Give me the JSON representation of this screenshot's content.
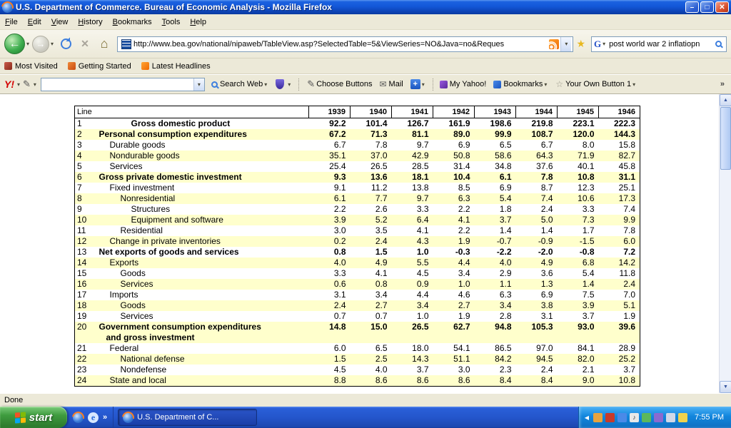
{
  "window": {
    "title": "U.S. Department of Commerce. Bureau of Economic Analysis - Mozilla Firefox"
  },
  "icons": {
    "dropdown": "▾",
    "back_arrow": "←",
    "forward_arrow": "→",
    "stop": "✕",
    "home": "⌂",
    "star": "★",
    "pencil": "✎",
    "mail": "✉",
    "plus": "+",
    "overflow": "»",
    "minimize": "–",
    "maximize": "□",
    "close": "✕",
    "up_arrow": "▲",
    "down_arrow": "▼",
    "tray_chevron": "◀",
    "own_star": "☆"
  },
  "menubar": {
    "items": [
      "File",
      "Edit",
      "View",
      "History",
      "Bookmarks",
      "Tools",
      "Help"
    ]
  },
  "navbar": {
    "url": "http://www.bea.gov/national/nipaweb/TableView.asp?SelectedTable=5&ViewSeries=NO&Java=no&Reques",
    "search_engine_label": "G",
    "search_value": "post world war 2 inflatiopn"
  },
  "bookmarks_bar": {
    "items": [
      "Most Visited",
      "Getting Started",
      "Latest Headlines"
    ]
  },
  "yahoo_bar": {
    "logo": "Y!",
    "search_button": "Search Web",
    "buttons": [
      "Choose Buttons",
      "Mail",
      "My Yahoo!",
      "Bookmarks",
      "Your Own Button 1"
    ]
  },
  "table": {
    "line_header": "Line",
    "years": [
      "1939",
      "1940",
      "1941",
      "1942",
      "1943",
      "1944",
      "1945",
      "1946"
    ],
    "rows": [
      {
        "line": "1",
        "label": "Gross domestic product",
        "indent": 3,
        "bold": true,
        "values": [
          "92.2",
          "101.4",
          "126.7",
          "161.9",
          "198.6",
          "219.8",
          "223.1",
          "222.3"
        ]
      },
      {
        "line": "2",
        "label": "Personal consumption expenditures",
        "indent": 0,
        "bold": true,
        "values": [
          "67.2",
          "71.3",
          "81.1",
          "89.0",
          "99.9",
          "108.7",
          "120.0",
          "144.3"
        ]
      },
      {
        "line": "3",
        "label": "Durable goods",
        "indent": 1,
        "bold": false,
        "values": [
          "6.7",
          "7.8",
          "9.7",
          "6.9",
          "6.5",
          "6.7",
          "8.0",
          "15.8"
        ]
      },
      {
        "line": "4",
        "label": "Nondurable goods",
        "indent": 1,
        "bold": false,
        "values": [
          "35.1",
          "37.0",
          "42.9",
          "50.8",
          "58.6",
          "64.3",
          "71.9",
          "82.7"
        ]
      },
      {
        "line": "5",
        "label": "Services",
        "indent": 1,
        "bold": false,
        "values": [
          "25.4",
          "26.5",
          "28.5",
          "31.4",
          "34.8",
          "37.6",
          "40.1",
          "45.8"
        ]
      },
      {
        "line": "6",
        "label": "Gross private domestic investment",
        "indent": 0,
        "bold": true,
        "values": [
          "9.3",
          "13.6",
          "18.1",
          "10.4",
          "6.1",
          "7.8",
          "10.8",
          "31.1"
        ]
      },
      {
        "line": "7",
        "label": "Fixed investment",
        "indent": 1,
        "bold": false,
        "values": [
          "9.1",
          "11.2",
          "13.8",
          "8.5",
          "6.9",
          "8.7",
          "12.3",
          "25.1"
        ]
      },
      {
        "line": "8",
        "label": "Nonresidential",
        "indent": 2,
        "bold": false,
        "values": [
          "6.1",
          "7.7",
          "9.7",
          "6.3",
          "5.4",
          "7.4",
          "10.6",
          "17.3"
        ]
      },
      {
        "line": "9",
        "label": "Structures",
        "indent": 3,
        "bold": false,
        "values": [
          "2.2",
          "2.6",
          "3.3",
          "2.2",
          "1.8",
          "2.4",
          "3.3",
          "7.4"
        ]
      },
      {
        "line": "10",
        "label": "Equipment and software",
        "indent": 3,
        "bold": false,
        "values": [
          "3.9",
          "5.2",
          "6.4",
          "4.1",
          "3.7",
          "5.0",
          "7.3",
          "9.9"
        ]
      },
      {
        "line": "11",
        "label": "Residential",
        "indent": 2,
        "bold": false,
        "values": [
          "3.0",
          "3.5",
          "4.1",
          "2.2",
          "1.4",
          "1.4",
          "1.7",
          "7.8"
        ]
      },
      {
        "line": "12",
        "label": "Change in private inventories",
        "indent": 1,
        "bold": false,
        "values": [
          "0.2",
          "2.4",
          "4.3",
          "1.9",
          "-0.7",
          "-0.9",
          "-1.5",
          "6.0"
        ]
      },
      {
        "line": "13",
        "label": "Net exports of goods and services",
        "indent": 0,
        "bold": true,
        "values": [
          "0.8",
          "1.5",
          "1.0",
          "-0.3",
          "-2.2",
          "-2.0",
          "-0.8",
          "7.2"
        ]
      },
      {
        "line": "14",
        "label": "Exports",
        "indent": 1,
        "bold": false,
        "values": [
          "4.0",
          "4.9",
          "5.5",
          "4.4",
          "4.0",
          "4.9",
          "6.8",
          "14.2"
        ]
      },
      {
        "line": "15",
        "label": "Goods",
        "indent": 2,
        "bold": false,
        "values": [
          "3.3",
          "4.1",
          "4.5",
          "3.4",
          "2.9",
          "3.6",
          "5.4",
          "11.8"
        ]
      },
      {
        "line": "16",
        "label": "Services",
        "indent": 2,
        "bold": false,
        "values": [
          "0.6",
          "0.8",
          "0.9",
          "1.0",
          "1.1",
          "1.3",
          "1.4",
          "2.4"
        ]
      },
      {
        "line": "17",
        "label": "Imports",
        "indent": 1,
        "bold": false,
        "values": [
          "3.1",
          "3.4",
          "4.4",
          "4.6",
          "6.3",
          "6.9",
          "7.5",
          "7.0"
        ]
      },
      {
        "line": "18",
        "label": "Goods",
        "indent": 2,
        "bold": false,
        "values": [
          "2.4",
          "2.7",
          "3.4",
          "2.7",
          "3.4",
          "3.8",
          "3.9",
          "5.1"
        ]
      },
      {
        "line": "19",
        "label": "Services",
        "indent": 2,
        "bold": false,
        "values": [
          "0.7",
          "0.7",
          "1.0",
          "1.9",
          "2.8",
          "3.1",
          "3.7",
          "1.9"
        ]
      },
      {
        "line": "20",
        "label": "Government consumption expenditures",
        "label2": "and gross investment",
        "indent": 0,
        "bold": true,
        "values": [
          "14.8",
          "15.0",
          "26.5",
          "62.7",
          "94.8",
          "105.3",
          "93.0",
          "39.6"
        ]
      },
      {
        "line": "21",
        "label": "Federal",
        "indent": 1,
        "bold": false,
        "values": [
          "6.0",
          "6.5",
          "18.0",
          "54.1",
          "86.5",
          "97.0",
          "84.1",
          "28.9"
        ]
      },
      {
        "line": "22",
        "label": "National defense",
        "indent": 2,
        "bold": false,
        "values": [
          "1.5",
          "2.5",
          "14.3",
          "51.1",
          "84.2",
          "94.5",
          "82.0",
          "25.2"
        ]
      },
      {
        "line": "23",
        "label": "Nondefense",
        "indent": 2,
        "bold": false,
        "values": [
          "4.5",
          "4.0",
          "3.7",
          "3.0",
          "2.3",
          "2.4",
          "2.1",
          "3.7"
        ]
      },
      {
        "line": "24",
        "label": "State and local",
        "indent": 1,
        "bold": false,
        "values": [
          "8.8",
          "8.6",
          "8.6",
          "8.6",
          "8.4",
          "8.4",
          "9.0",
          "10.8"
        ]
      }
    ]
  },
  "statusbar": {
    "text": "Done"
  },
  "taskbar": {
    "start_label": "start",
    "task_label": "U.S. Department of C...",
    "clock": "7:55 PM"
  }
}
